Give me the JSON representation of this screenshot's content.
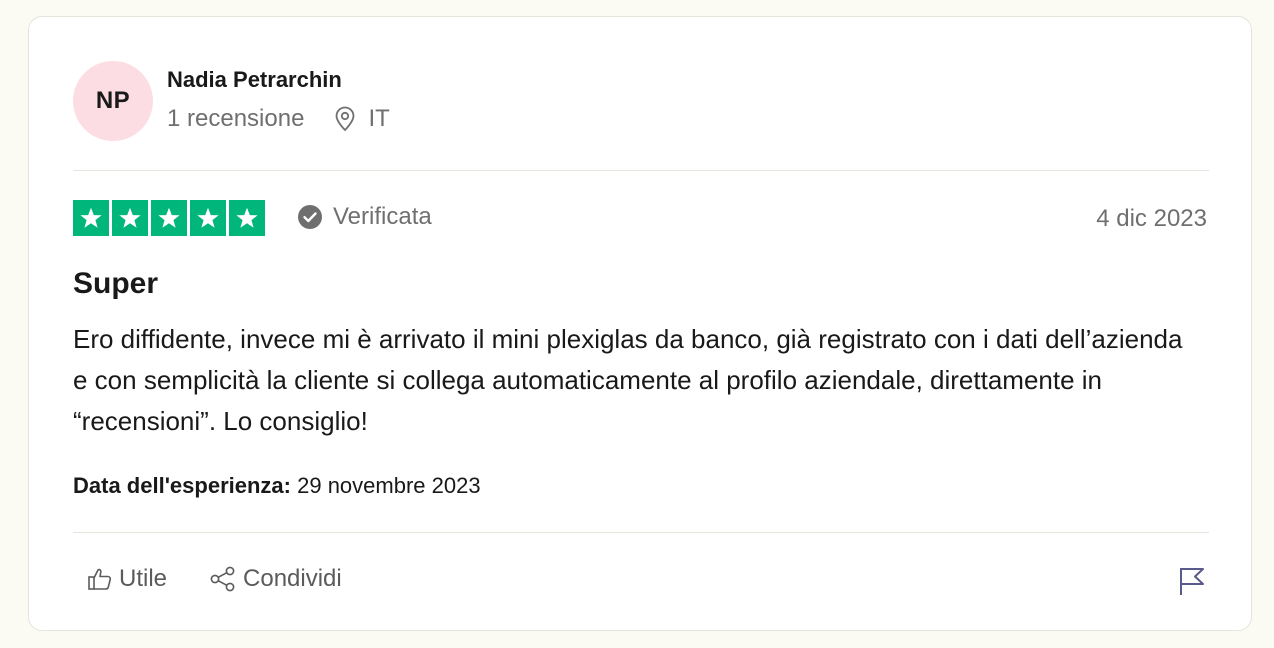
{
  "reviewer": {
    "initials": "NP",
    "name": "Nadia Petrarchin",
    "review_count": "1 recensione",
    "country": "IT"
  },
  "review": {
    "rating": 5,
    "rating_max": 5,
    "verified_label": "Verificata",
    "date": "4 dic 2023",
    "title": "Super",
    "body": "Ero diffidente, invece mi è arrivato il mini plexiglas da banco, già registrato con i dati dell’azienda e con semplicità la cliente si collega automaticamente al profilo aziendale, direttamente in “recensioni”. Lo consiglio!",
    "experience_label": "Data dell'esperienza:",
    "experience_date": "29 novembre 2023"
  },
  "actions": {
    "like_label": "Utile",
    "share_label": "Condividi"
  },
  "colors": {
    "star_green": "#00b67a",
    "avatar_bg": "#fcdde3",
    "page_bg": "#fbfaf3"
  },
  "icons": [
    "location-icon",
    "verified-check-icon",
    "thumbs-up-icon",
    "share-icon",
    "flag-icon",
    "star-icon"
  ]
}
